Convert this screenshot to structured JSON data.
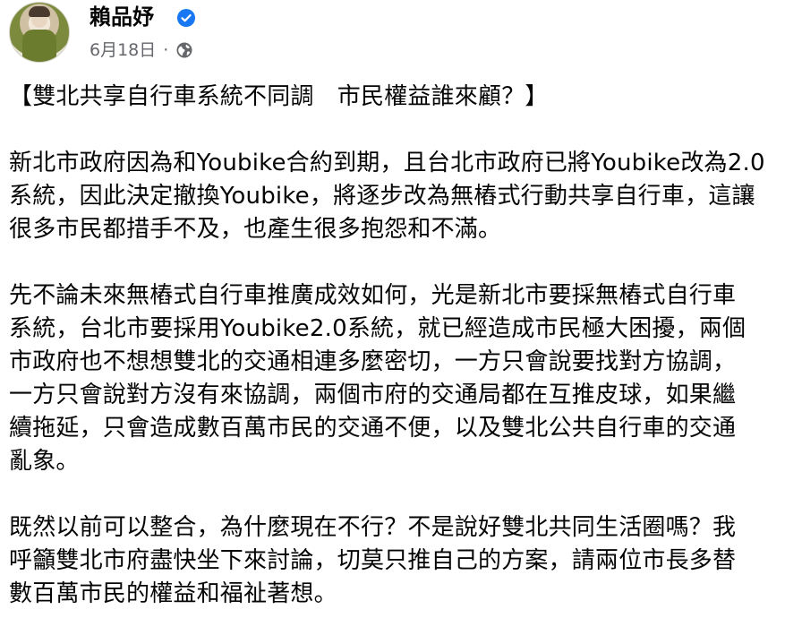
{
  "post": {
    "author": "賴品妤",
    "date": "6月18日",
    "separator": "·",
    "icons": {
      "verified": "verified-badge-icon",
      "privacy": "globe-icon"
    },
    "colors": {
      "verified": "#1877f2",
      "meta_text": "#65676b",
      "body_text": "#050505"
    },
    "title": "【雙北共享自行車系統不同調　市民權益誰來顧？】",
    "paragraphs": [
      [
        "新北市政府因為和Youbike合約到期，且台北市政府已將Youbike改為2.0",
        "系統，因此決定撤換Youbike，將逐步改為無樁式行動共享自行車，這讓",
        "很多市民都措手不及，也產生很多抱怨和不滿。"
      ],
      [
        "先不論未來無樁式自行車推廣成效如何，光是新北市要採無樁式自行車",
        "系統，台北市要採用Youbike2.0系統，就已經造成市民極大困擾，兩個",
        "市政府也不想想雙北的交通相連多麼密切，一方只會說要找對方協調，",
        "一方只會說對方沒有來協調，兩個市府的交通局都在互推皮球，如果繼",
        "續拖延，只會造成數百萬市民的交通不便，以及雙北公共自行車的交通",
        "亂象。"
      ],
      [
        "既然以前可以整合，為什麼現在不行？不是說好雙北共同生活圈嗎？我",
        "呼籲雙北市府盡快坐下來討論，切莫只推自己的方案，請兩位市長多替",
        "數百萬市民的權益和福祉著想。"
      ]
    ]
  }
}
